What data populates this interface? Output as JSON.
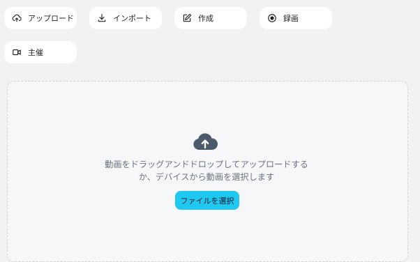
{
  "actions": {
    "upload": {
      "label": "アップロード",
      "icon": "cloud-upload-icon"
    },
    "import": {
      "label": "インポート",
      "icon": "download-icon"
    },
    "create": {
      "label": "作成",
      "icon": "edit-icon"
    },
    "record": {
      "label": "録画",
      "icon": "record-icon"
    },
    "host": {
      "label": "主催",
      "icon": "video-camera-icon"
    }
  },
  "dropzone": {
    "icon": "cloud-upload-icon",
    "text": "動画をドラッグアンドドロップしてアップロードするか、デバイスから動画を選択します",
    "button_label": "ファイルを選択"
  },
  "colors": {
    "page_bg": "#f1f2f4",
    "button_bg": "#ffffff",
    "accent": "#1ec8f0",
    "cloud_icon": "#4b5b6b",
    "muted_text": "#6b7280"
  }
}
